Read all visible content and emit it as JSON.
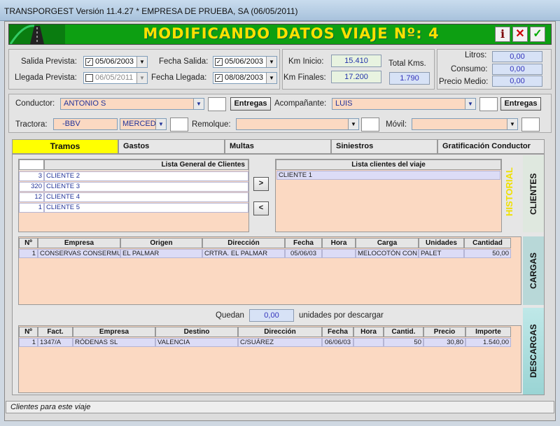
{
  "window": {
    "title": "TRANSPORGEST Versión 11.4.27 * EMPRESA DE PRUEBA, SA (06/05/2011)"
  },
  "header": {
    "title": "MODIFICANDO DATOS VIAJE Nº: 4",
    "info_icon": "i",
    "close_icon": "✕",
    "ok_icon": "✓"
  },
  "dates": {
    "salida_prevista_label": "Salida Prevista:",
    "salida_prevista": "05/06/2003",
    "llegada_prevista_label": "Llegada Prevista:",
    "llegada_prevista": "06/05/2011",
    "fecha_salida_label": "Fecha Salida:",
    "fecha_salida": "05/06/2003",
    "fecha_llegada_label": "Fecha Llegada:",
    "fecha_llegada": "08/08/2003"
  },
  "km": {
    "inicio_label": "Km Inicio:",
    "inicio": "15.410",
    "finales_label": "Km Finales:",
    "finales": "17.200",
    "total_label": "Total Kms.",
    "total": "1.790"
  },
  "fuel": {
    "litros_label": "Litros:",
    "litros": "0,00",
    "consumo_label": "Consumo:",
    "consumo": "0,00",
    "precio_label": "Precio Medio:",
    "precio": "0,00"
  },
  "crew": {
    "conductor_label": "Conductor:",
    "conductor": "ANTONIO S",
    "acompanante_label": "Acompañante:",
    "acompanante": "LUIS",
    "entregas_label": "Entregas"
  },
  "vehicle": {
    "tractora_label": "Tractora:",
    "tractora": "-BBV",
    "tractora_loc": "MERCED",
    "remolque_label": "Remolque:",
    "movil_label": "Móvil:"
  },
  "tabs": [
    "Tramos",
    "Gastos",
    "Multas",
    "Siniestros",
    "Gratificación Conductor"
  ],
  "clientes": {
    "lista_general_title": "Lista General de Clientes",
    "lista_general": [
      {
        "n": "3",
        "name": "CLIENTE 2"
      },
      {
        "n": "320",
        "name": "CLIENTE 3"
      },
      {
        "n": "12",
        "name": "CLIENTE 4"
      },
      {
        "n": "1",
        "name": "CLIENTE 5"
      }
    ],
    "lista_viaje_title": "Lista clientes del viaje",
    "lista_viaje": [
      "CLIENTE 1"
    ],
    "add_button": ">",
    "remove_button": "<",
    "historial": "HISTORIAL",
    "side_label": "CLIENTES"
  },
  "cargas": {
    "side_label": "CARGAS",
    "headers": [
      "Nº",
      "Empresa",
      "Origen",
      "Dirección",
      "Fecha",
      "Hora",
      "Carga",
      "Unidades",
      "Cantidad"
    ],
    "rows": [
      [
        "1",
        "CONSERVAS CONSERMU",
        "EL PALMAR",
        "CRTRA. EL PALMAR",
        "05/06/03",
        "",
        "MELOCOTÓN CON",
        "PALET",
        "50,00"
      ]
    ]
  },
  "quedan": {
    "label": "Quedan",
    "value": "0,00",
    "suffix": "unidades por descargar"
  },
  "descargas": {
    "side_label": "DESCARGAS",
    "headers": [
      "Nº",
      "Fact.",
      "Empresa",
      "Destino",
      "Dirección",
      "Fecha",
      "Hora",
      "Cantid.",
      "Precio",
      "Importe"
    ],
    "rows": [
      [
        "1",
        "1347/A",
        "RÓDENAS SL",
        "VALENCIA",
        "C/SUÁREZ",
        "06/06/03",
        "",
        "50",
        "30,80",
        "1.540,00"
      ]
    ]
  },
  "status": "Clientes para este viaje"
}
